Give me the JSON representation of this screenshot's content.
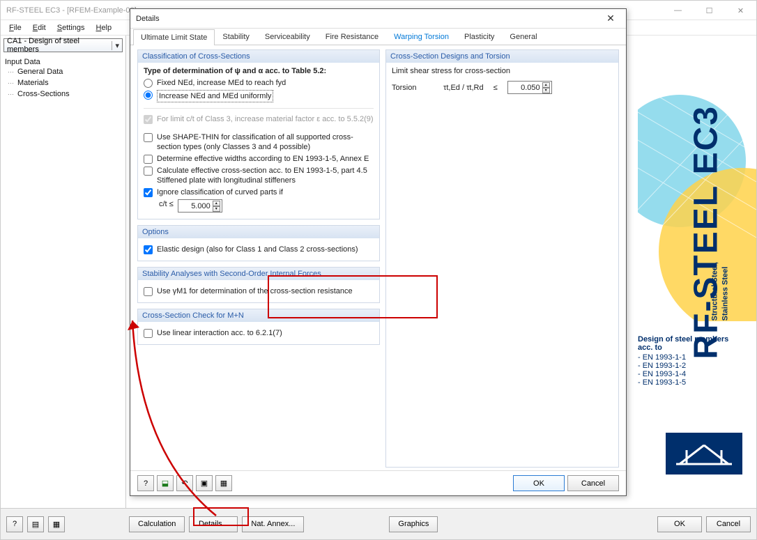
{
  "window": {
    "title": "RF-STEEL EC3 - [RFEM-Example-03]"
  },
  "menu": {
    "file": "File",
    "edit": "Edit",
    "settings": "Settings",
    "help": "Help"
  },
  "case_dropdown": "CA1 - Design of steel members",
  "tree": {
    "root": "Input Data",
    "items": [
      "General Data",
      "Materials",
      "Cross-Sections"
    ]
  },
  "brand": {
    "title": "RF-STEEL EC3",
    "subtitle1": "Structural Steel,",
    "subtitle2": "Stainless Steel",
    "desc_head": "Design of steel members acc. to",
    "desc_lines": [
      "- EN 1993-1-1",
      "- EN 1993-1-2",
      "- EN 1993-1-4",
      "- EN 1993-1-5"
    ]
  },
  "bottom": {
    "calculation": "Calculation",
    "details": "Details...",
    "nat_annex": "Nat. Annex...",
    "graphics": "Graphics",
    "ok": "OK",
    "cancel": "Cancel"
  },
  "dialog": {
    "title": "Details",
    "tabs": [
      "Ultimate Limit State",
      "Stability",
      "Serviceability",
      "Fire Resistance",
      "Warping Torsion",
      "Plasticity",
      "General"
    ],
    "group_class": {
      "title": "Classification of Cross-Sections",
      "type_label": "Type of determination of ψ and α acc. to Table 5.2:",
      "radio1": "Fixed NEd, increase MEd to reach fyd",
      "radio2": "Increase NEd and MEd uniformly",
      "chk_limit": "For limit c/t of Class 3, increase material factor ε acc. to 5.5.2(9)",
      "chk_shape": "Use SHAPE-THIN for classification of all supported cross-section types (only Classes 3 and 4 possible)",
      "chk_eff": "Determine effective widths according to EN 1993-1-5, Annex E",
      "chk_calc": "Calculate effective cross-section acc. to EN 1993-1-5, part 4.5 Stiffened plate with longitudinal stiffeners",
      "chk_ignore": "Ignore classification of curved parts if",
      "ct_label": "c/t ≤",
      "ct_value": "5.000"
    },
    "group_options": {
      "title": "Options",
      "chk_elastic": "Elastic design (also for Class 1 and Class 2 cross-sections)"
    },
    "group_stability": {
      "title": "Stability Analyses with Second-Order Internal Forces",
      "chk_gamma": "Use γM1 for determination of the cross-section resistance"
    },
    "group_mn": {
      "title": "Cross-Section Check for M+N",
      "chk_linear": "Use linear interaction acc. to 6.2.1(7)"
    },
    "group_torsion": {
      "title": "Cross-Section Designs and Torsion",
      "label1": "Limit shear stress for cross-section",
      "label2": "Torsion",
      "ratio": "τt,Ed / τt,Rd",
      "le": "≤",
      "value": "0.050"
    },
    "footer": {
      "ok": "OK",
      "cancel": "Cancel"
    }
  }
}
